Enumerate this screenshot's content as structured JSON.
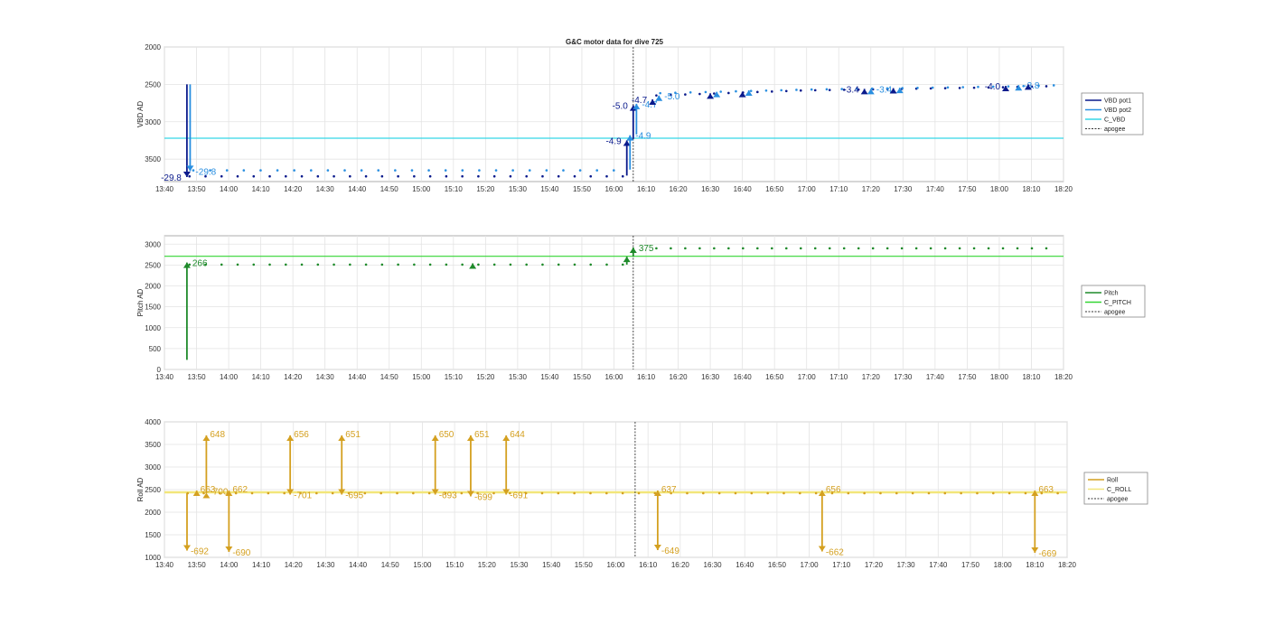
{
  "figure_title": "G&C motor data for dive 725",
  "apogee_time": "16:06",
  "colors": {
    "vbd_pot1": "#0a1a8c",
    "vbd_pot2": "#2a8fe0",
    "c_vbd": "#35d6e6",
    "pitch": "#1e8a2a",
    "c_pitch": "#33d633",
    "roll": "#d4a020",
    "c_roll": "#f2e67a",
    "apogee": "#333333"
  },
  "chart_data": [
    {
      "type": "scatter",
      "ylabel": "VBD AD",
      "xlim": [
        "13:40",
        "18:20"
      ],
      "ylim": [
        2000,
        3800
      ],
      "y_reversed": true,
      "yticks": [
        2000,
        2500,
        3000,
        3500
      ],
      "xticks": [
        "13:40",
        "13:50",
        "14:00",
        "14:10",
        "14:20",
        "14:30",
        "14:40",
        "14:50",
        "15:00",
        "15:10",
        "15:20",
        "15:30",
        "15:40",
        "15:50",
        "16:00",
        "16:10",
        "16:20",
        "16:30",
        "16:40",
        "16:50",
        "17:00",
        "17:10",
        "17:20",
        "17:30",
        "17:40",
        "17:50",
        "18:00",
        "18:10",
        "18:20"
      ],
      "grid": true,
      "legend": {
        "position": "right",
        "entries": [
          "VBD pot1",
          "VBD pot2",
          "C_VBD",
          "apogee"
        ]
      },
      "reference_line": {
        "name": "C_VBD",
        "y": 3220
      },
      "series": [
        {
          "name": "VBD pot1",
          "level_before_apogee": 3730,
          "level_after_apogee": [
            [
              16.2,
              2650
            ],
            [
              17.0,
              2580
            ],
            [
              18.0,
              2540
            ],
            [
              18.33,
              2520
            ]
          ]
        },
        {
          "name": "VBD pot2",
          "level_before_apogee": 3650,
          "level_after_apogee": [
            [
              16.2,
              2620
            ],
            [
              17.0,
              2570
            ],
            [
              18.0,
              2530
            ],
            [
              18.33,
              2510
            ]
          ]
        }
      ],
      "moves": [
        {
          "series": "VBD pot1",
          "time": "13:47",
          "from": 2500,
          "to": 3740,
          "label": "-29.8"
        },
        {
          "series": "VBD pot2",
          "time": "13:48",
          "from": 2500,
          "to": 3660,
          "label": "-29.8"
        },
        {
          "series": "VBD pot1",
          "time": "16:04",
          "from": 3720,
          "to": 3250,
          "label": "-4.9"
        },
        {
          "series": "VBD pot2",
          "time": "16:05",
          "from": 3640,
          "to": 3180,
          "label": "-4.9"
        },
        {
          "series": "VBD pot1",
          "time": "16:06",
          "from": 3230,
          "to": 2780,
          "label": "-5.0"
        },
        {
          "series": "VBD pot2",
          "time": "16:07",
          "from": 3170,
          "to": 2760,
          "label": "-4.7"
        },
        {
          "series": "VBD pot1",
          "time": "16:12",
          "from": 2750,
          "to": 2700,
          "label": "-4.7"
        },
        {
          "series": "VBD pot2",
          "time": "16:14",
          "from": 2700,
          "to": 2650,
          "label": "-5.0"
        },
        {
          "series": "VBD pot1",
          "time": "16:30",
          "from": 2650,
          "to": 2620,
          "label": ""
        },
        {
          "series": "VBD pot2",
          "time": "16:32",
          "from": 2630,
          "to": 2600,
          "label": ""
        },
        {
          "series": "VBD pot1",
          "time": "16:40",
          "from": 2620,
          "to": 2600,
          "label": ""
        },
        {
          "series": "VBD pot2",
          "time": "16:42",
          "from": 2600,
          "to": 2580,
          "label": ""
        },
        {
          "series": "VBD pot1",
          "time": "17:18",
          "from": 2590,
          "to": 2560,
          "label": "-3.4"
        },
        {
          "series": "VBD pot2",
          "time": "17:20",
          "from": 2580,
          "to": 2560,
          "label": "-3.4"
        },
        {
          "series": "VBD pot1",
          "time": "17:27",
          "from": 2580,
          "to": 2550,
          "label": ""
        },
        {
          "series": "VBD pot2",
          "time": "17:29",
          "from": 2560,
          "to": 2545,
          "label": ""
        },
        {
          "series": "VBD pot1",
          "time": "18:02",
          "from": 2545,
          "to": 2520,
          "label": "-4.0"
        },
        {
          "series": "VBD pot2",
          "time": "18:06",
          "from": 2530,
          "to": 2510,
          "label": "-3.8"
        },
        {
          "series": "VBD pot1",
          "time": "18:09",
          "from": 2520,
          "to": 2500,
          "label": ""
        }
      ]
    },
    {
      "type": "scatter",
      "ylabel": "Pitch AD",
      "xlim": [
        "13:40",
        "18:20"
      ],
      "ylim": [
        0,
        3200
      ],
      "yticks": [
        0,
        500,
        1000,
        1500,
        2000,
        2500,
        3000
      ],
      "xticks": [
        "13:40",
        "13:50",
        "14:00",
        "14:10",
        "14:20",
        "14:30",
        "14:40",
        "14:50",
        "15:00",
        "15:10",
        "15:20",
        "15:30",
        "15:40",
        "15:50",
        "16:00",
        "16:10",
        "16:20",
        "16:30",
        "16:40",
        "16:50",
        "17:00",
        "17:10",
        "17:20",
        "17:30",
        "17:40",
        "17:50",
        "18:00",
        "18:10",
        "18:20"
      ],
      "grid": true,
      "legend": {
        "position": "right",
        "entries": [
          "Pitch",
          "C_PITCH",
          "apogee"
        ]
      },
      "reference_line": {
        "name": "C_PITCH",
        "y": 2710
      },
      "series": [
        {
          "name": "Pitch",
          "level_before_apogee": 2510,
          "level_after_apogee": [
            [
              16.2,
              2900
            ],
            [
              18.33,
              2900
            ]
          ]
        }
      ],
      "moves": [
        {
          "series": "Pitch",
          "time": "13:47",
          "from": 230,
          "to": 2560,
          "label": "266"
        },
        {
          "series": "Pitch",
          "time": "15:16",
          "from": 2510,
          "to": 2540,
          "label": ""
        },
        {
          "series": "Pitch",
          "time": "16:04",
          "from": 2510,
          "to": 2700,
          "label": ""
        },
        {
          "series": "Pitch",
          "time": "16:06",
          "from": 2700,
          "to": 2920,
          "label": "375"
        }
      ]
    },
    {
      "type": "scatter",
      "ylabel": "Roll AD",
      "xlim": [
        "13:40",
        "18:20"
      ],
      "ylim": [
        1000,
        4000
      ],
      "yticks": [
        1000,
        1500,
        2000,
        2500,
        3000,
        3500,
        4000
      ],
      "xticks": [
        "13:40",
        "13:50",
        "14:00",
        "14:10",
        "14:20",
        "14:30",
        "14:40",
        "14:50",
        "15:00",
        "15:10",
        "15:20",
        "15:30",
        "15:40",
        "15:50",
        "16:00",
        "16:10",
        "16:20",
        "16:30",
        "16:40",
        "16:50",
        "17:00",
        "17:10",
        "17:20",
        "17:30",
        "17:40",
        "17:50",
        "18:00",
        "18:10",
        "18:20"
      ],
      "grid": true,
      "legend": {
        "position": "right",
        "entries": [
          "Roll",
          "C_ROLL",
          "apogee"
        ]
      },
      "reference_line": {
        "name": "C_ROLL",
        "y": 2440
      },
      "series": [
        {
          "name": "Roll",
          "level": 2420
        }
      ],
      "spikes": [
        {
          "time": "13:47",
          "to": 1150,
          "label": "-692"
        },
        {
          "time": "13:50",
          "to": 2480,
          "label": "663"
        },
        {
          "time": "13:53",
          "to": 3700,
          "label": "648"
        },
        {
          "time": "13:53",
          "to": 2430,
          "label": "-700"
        },
        {
          "time": "14:00",
          "to": 2480,
          "label": "662"
        },
        {
          "time": "14:00",
          "to": 1120,
          "label": "-690"
        },
        {
          "time": "14:19",
          "to": 3700,
          "label": "656"
        },
        {
          "time": "14:19",
          "to": 2390,
          "label": "-701"
        },
        {
          "time": "14:35",
          "to": 3700,
          "label": "651"
        },
        {
          "time": "14:35",
          "to": 2390,
          "label": "-695"
        },
        {
          "time": "15:04",
          "to": 3700,
          "label": "650"
        },
        {
          "time": "15:04",
          "to": 2390,
          "label": "-693"
        },
        {
          "time": "15:15",
          "to": 3700,
          "label": "651"
        },
        {
          "time": "15:15",
          "to": 2350,
          "label": "-699"
        },
        {
          "time": "15:26",
          "to": 3700,
          "label": "644"
        },
        {
          "time": "15:26",
          "to": 2390,
          "label": "-691"
        },
        {
          "time": "16:13",
          "to": 2480,
          "label": "637"
        },
        {
          "time": "16:13",
          "to": 1160,
          "label": "-649"
        },
        {
          "time": "17:04",
          "to": 2480,
          "label": "656"
        },
        {
          "time": "17:04",
          "to": 1130,
          "label": "-662"
        },
        {
          "time": "18:10",
          "to": 2480,
          "label": "663"
        },
        {
          "time": "18:10",
          "to": 1100,
          "label": "-669"
        }
      ]
    }
  ]
}
